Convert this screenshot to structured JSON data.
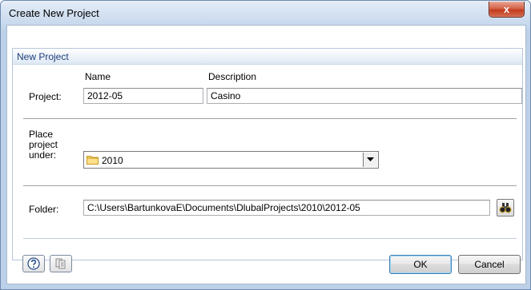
{
  "window": {
    "title": "Create New Project",
    "close_label": "x"
  },
  "group": {
    "title": "New Project",
    "name_header": "Name",
    "description_header": "Description",
    "project_label": "Project:",
    "name_value": "2012-05",
    "description_value": "Casino",
    "place_label_line1": "Place",
    "place_label_line2": "project",
    "place_label_line3": "under:",
    "place_value": "2010",
    "folder_label": "Folder:",
    "folder_value": "C:\\Users\\BartunkovaE\\Documents\\DlubalProjects\\2010\\2012-05"
  },
  "footer": {
    "ok_label": "OK",
    "cancel_label": "Cancel"
  },
  "icons": {
    "help": "help-icon",
    "details": "details-icon",
    "browse": "binoculars-icon",
    "folder": "folder-icon",
    "dropdown": "chevron-down-icon"
  }
}
